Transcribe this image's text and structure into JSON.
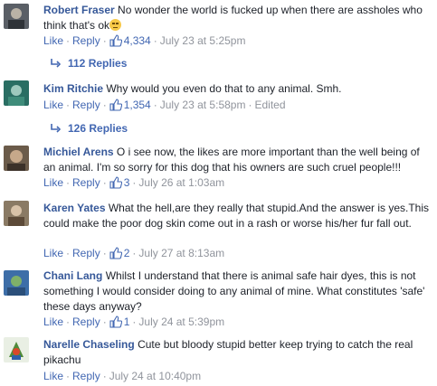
{
  "comments": [
    {
      "author": "Robert Fraser",
      "text": "No wonder the world is fucked up when there are assholes who think that's ok",
      "like": "Like",
      "reply": "Reply",
      "likes": "4,334",
      "time": "July 23 at 5:25pm",
      "edited": "",
      "replies": "112 Replies",
      "avatar_color": "#5a5f66"
    },
    {
      "author": "Kim Ritchie",
      "text": "Why would you even do that to any animal. Smh.",
      "like": "Like",
      "reply": "Reply",
      "likes": "1,354",
      "time": "July 23 at 5:58pm",
      "edited": "Edited",
      "replies": "126 Replies",
      "avatar_color": "#3f8c7a"
    },
    {
      "author": "Michiel Arens",
      "text": "O i see now, the likes are more important than the well being of an animal. I'm so sorry for this dog that his owners are such cruel people!!!",
      "like": "Like",
      "reply": "Reply",
      "likes": "3",
      "time": "July 26 at 1:03am",
      "avatar_color": "#6b5b4a"
    },
    {
      "author": "Karen Yates",
      "text": "What the hell,are they really that stupid.And the answer is yes.This could make the poor dog skin come out in a rash or worse his/her fur fall out.",
      "like": "Like",
      "reply": "Reply",
      "likes": "2",
      "time": "July 27 at 8:13am",
      "avatar_color": "#8a7a64"
    },
    {
      "author": "Chani Lang",
      "text": "Whilst I understand that there is animal safe hair dyes, this is not something I would consider doing to any animal of mine. What constitutes 'safe' these days anyway?",
      "like": "Like",
      "reply": "Reply",
      "likes": "1",
      "time": "July 24 at 5:39pm",
      "avatar_color": "#3d6ea8"
    },
    {
      "author": "Narelle Chaseling",
      "text": "Cute but bloody stupid better keep trying to catch the real pikachu",
      "like": "Like",
      "reply": "Reply",
      "time": "July 24 at 10:40pm",
      "avatar_color": "#4f8a3a"
    }
  ],
  "colors": {
    "link": "#4267b2",
    "author": "#365899",
    "meta": "#90949c",
    "text": "#1d2129"
  }
}
